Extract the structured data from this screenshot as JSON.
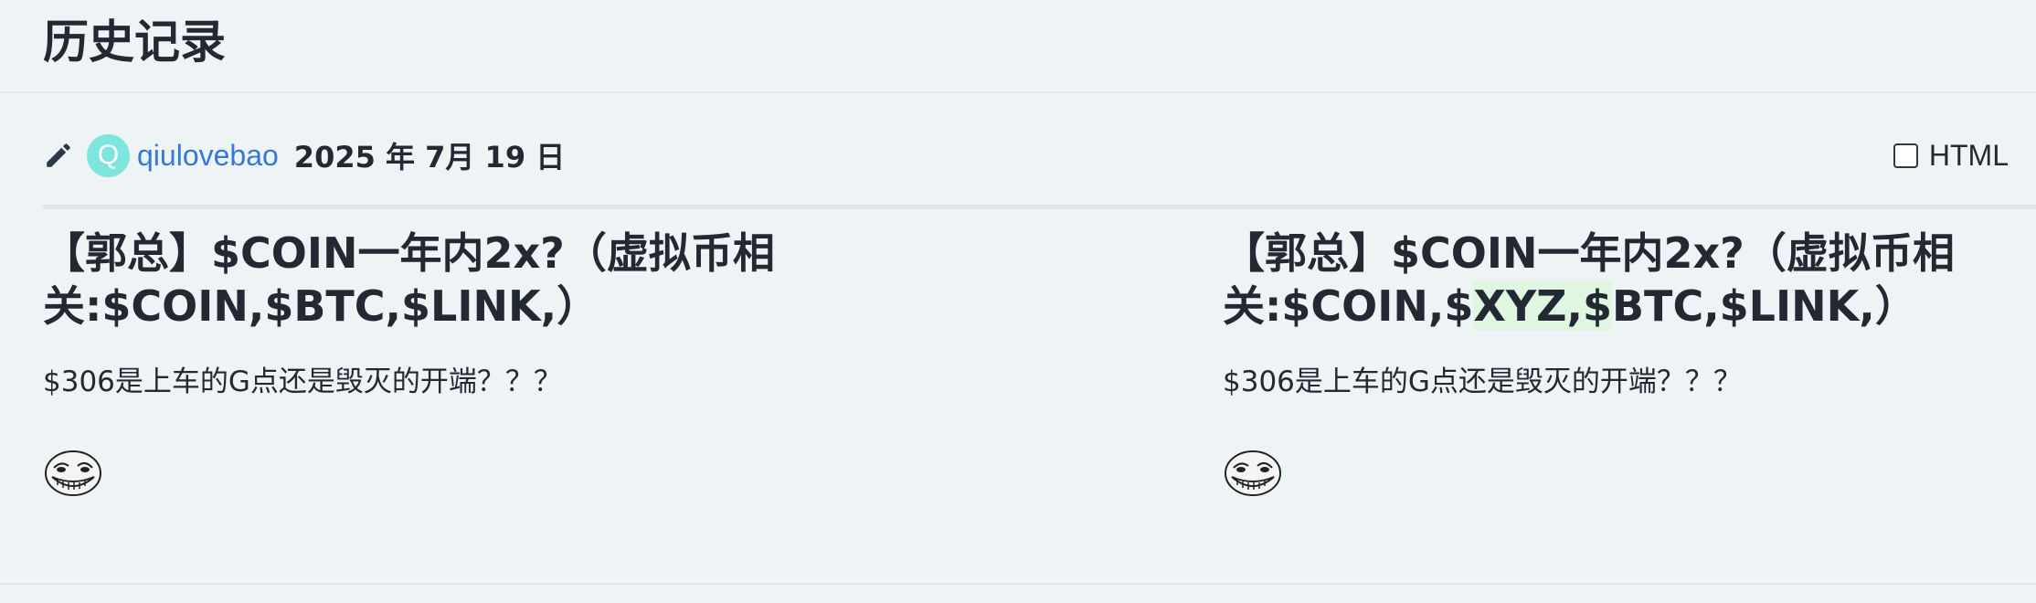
{
  "header": {
    "title": "历史记录"
  },
  "revision": {
    "editor_icon": "pencil-icon",
    "avatar_letter": "Q",
    "username": "qiulovebao",
    "date": "2025 年 7月 19 日",
    "html_toggle_label": "HTML",
    "html_toggle_checked": false
  },
  "diff": {
    "left": {
      "title": "【郭总】$COIN一年内2x?（虚拟币相关:$COIN,$BTC,$LINK,）",
      "body": "$306是上车的G点还是毁灭的开端？？？",
      "emoji": "trollface-emoji"
    },
    "right": {
      "title_before": "【郭总】$COIN一年内2x?（虚拟币相关:$COIN,$",
      "title_inserted": "XYZ,$",
      "title_after": "BTC,$LINK,）",
      "body": "$306是上车的G点还是毁灭的开端？？？",
      "emoji": "trollface-emoji"
    }
  },
  "colors": {
    "background": "#eef3f6",
    "link": "#3578d8",
    "avatar": "#7ee5dc",
    "insert_highlight": "#dff6e0"
  }
}
